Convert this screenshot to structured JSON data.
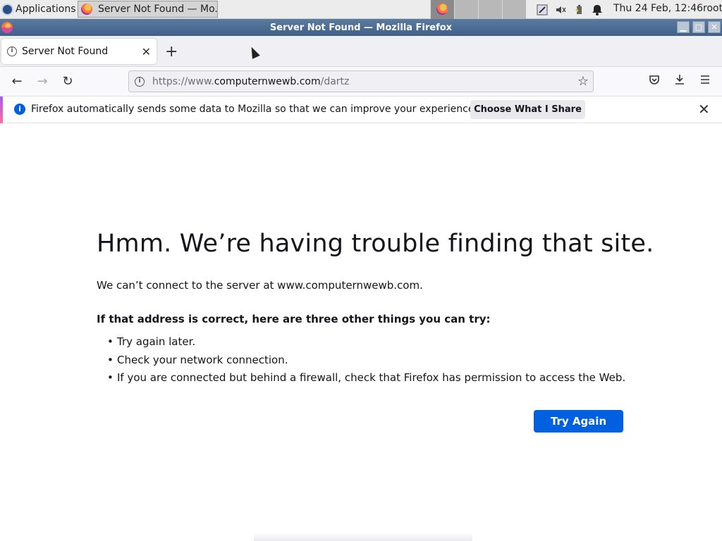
{
  "panel": {
    "applications_label": "Applications",
    "task_button_title": "Server Not Found — Mo...",
    "clock": "Thu 24 Feb, 12:46",
    "user": "root",
    "tray_icons": [
      "network-icon",
      "volume-muted-icon",
      "power-icon",
      "bell-icon"
    ]
  },
  "window": {
    "title": "Server Not Found — Mozilla Firefox"
  },
  "tab": {
    "title": "Server Not Found"
  },
  "urlbar": {
    "prefix": "https://www.",
    "domain": "computernwewb.com",
    "path": "/dartz"
  },
  "notice": {
    "message": "Firefox automatically sends some data to Mozilla so that we can improve your experience.",
    "button_label": "Choose What I Share"
  },
  "error": {
    "title": "Hmm. We’re having trouble finding that site.",
    "description": "We can’t connect to the server at www.computernwewb.com.",
    "try_heading": "If that address is correct, here are three other things you can try:",
    "tips": [
      "Try again later.",
      "Check your network connection.",
      "If you are connected but behind a firewall, check that Firefox has permission to access the Web."
    ],
    "try_again_label": "Try Again"
  },
  "colors": {
    "accent_blue": "#0060df",
    "titlebar": "#4a6a92"
  }
}
